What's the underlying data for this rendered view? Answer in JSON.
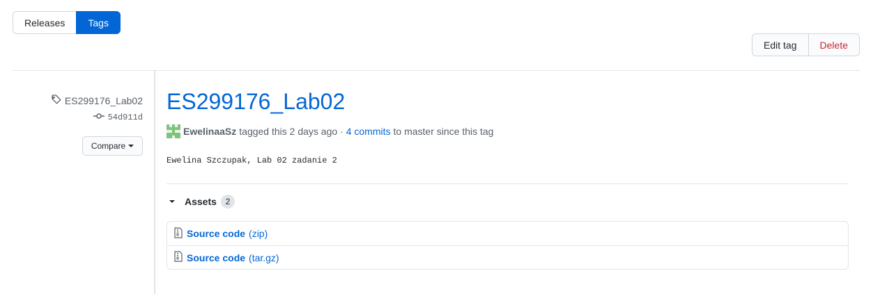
{
  "tabs": {
    "releases": "Releases",
    "tags": "Tags"
  },
  "actions": {
    "edit": "Edit tag",
    "delete": "Delete"
  },
  "sidebar": {
    "tag_name": "ES299176_Lab02",
    "commit_sha": "54d911d",
    "compare_label": "Compare"
  },
  "release": {
    "title": "ES299176_Lab02",
    "author": "EwelinaaSz",
    "tagged_text": "tagged this 2 days ago ·",
    "commits_link": "4 commits",
    "since_text": "to master since this tag",
    "description": "Ewelina Szczupak, Lab 02 zadanie 2"
  },
  "assets": {
    "label": "Assets",
    "count": "2",
    "items": [
      {
        "name": "Source code",
        "ext": "(zip)"
      },
      {
        "name": "Source code",
        "ext": "(tar.gz)"
      }
    ]
  },
  "colors": {
    "accent": "#0366d6",
    "danger": "#cb2431",
    "muted": "#586069",
    "border": "#e1e4e8"
  },
  "icons": {
    "tag": "tag-icon",
    "commit": "git-commit-icon",
    "zip": "file-zip-icon",
    "caret": "caret-down-icon",
    "avatar": "identicon-avatar"
  }
}
